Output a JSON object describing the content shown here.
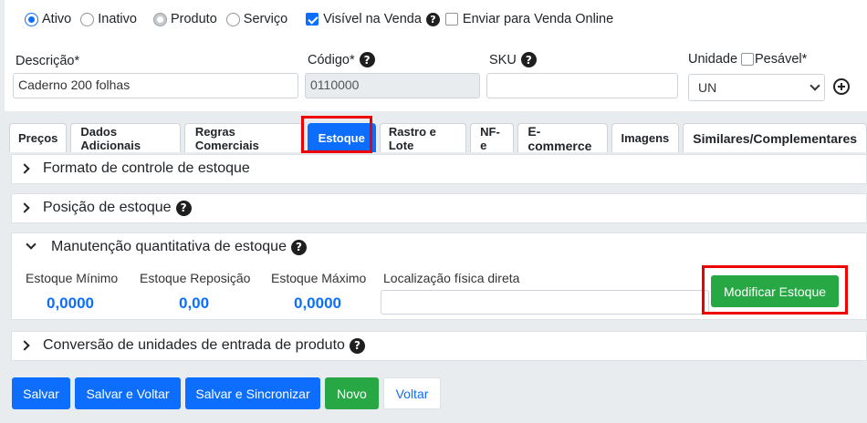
{
  "status": {
    "ativo": "Ativo",
    "inativo": "Inativo",
    "produto": "Produto",
    "servico": "Serviço",
    "visivel_na_venda": "Visível na Venda",
    "enviar_venda_online": "Enviar para Venda Online"
  },
  "fields": {
    "descricao_label": "Descrição*",
    "descricao_value": "Caderno 200 folhas",
    "codigo_label": "Código*",
    "codigo_value": "0110000",
    "sku_label": "SKU",
    "sku_value": "",
    "unidade_label": "Unidade",
    "pesavel_label": "Pesável*",
    "unidade_value": "UN"
  },
  "tabs": [
    {
      "label": "Preços"
    },
    {
      "label": "Dados Adicionais"
    },
    {
      "label": "Regras Comerciais"
    },
    {
      "label": "Estoque"
    },
    {
      "label": "Rastro e Lote"
    },
    {
      "label": "NF-e"
    },
    {
      "label": "E-commerce"
    },
    {
      "label": "Imagens"
    },
    {
      "label": "Similares/Complementares"
    }
  ],
  "active_tab": "Estoque",
  "sections": {
    "formato": "Formato de controle de estoque",
    "posicao": "Posição de estoque",
    "manutencao": "Manutenção quantitativa de estoque",
    "conversao": "Conversão de unidades de entrada de produto"
  },
  "stock": {
    "minimo_label": "Estoque Mínimo",
    "minimo_value": "0,0000",
    "reposicao_label": "Estoque Reposição",
    "reposicao_value": "0,00",
    "maximo_label": "Estoque Máximo",
    "maximo_value": "0,0000",
    "localizacao_label": "Localização física direta",
    "localizacao_value": "",
    "modificar_button": "Modificar Estoque"
  },
  "buttons": {
    "salvar": "Salvar",
    "salvar_voltar": "Salvar e Voltar",
    "salvar_sincronizar": "Salvar e Sincronizar",
    "novo": "Novo",
    "voltar": "Voltar"
  },
  "colors": {
    "primary": "#0d6efd",
    "success": "#28a745",
    "highlight": "#ee0000"
  }
}
